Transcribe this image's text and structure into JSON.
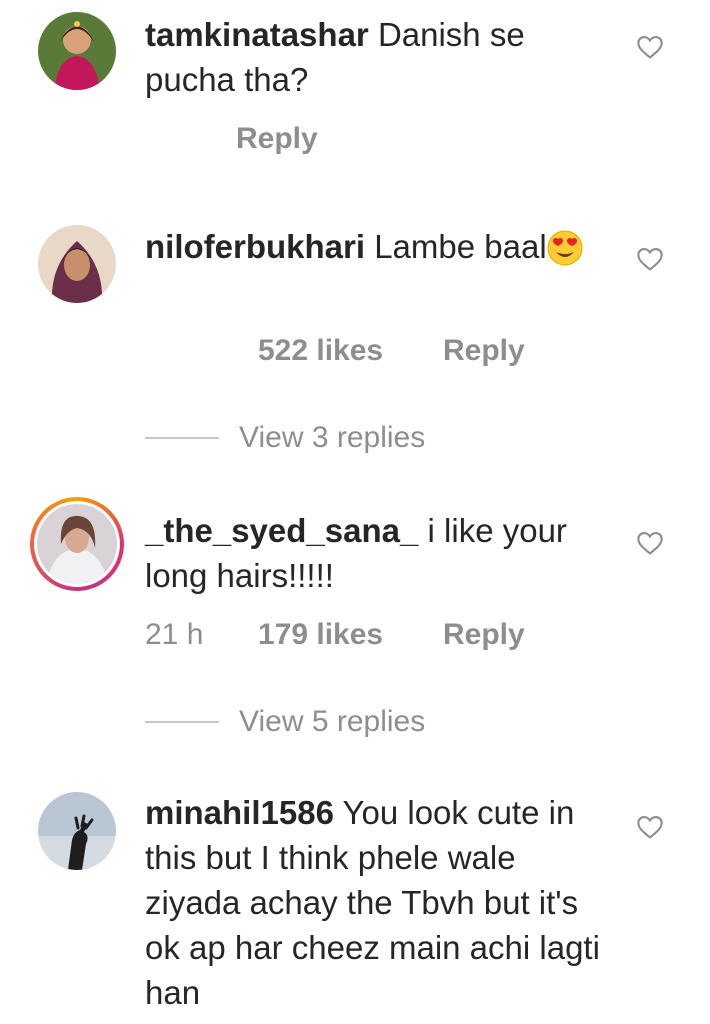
{
  "comments": [
    {
      "username": "tamkinatashar",
      "text": "Danish se pucha tha?",
      "reply_label": "Reply"
    },
    {
      "username": "niloferbukhari",
      "text": "Lambe baal",
      "emoji": "heart-eyes-emoji",
      "likes": "522 likes",
      "reply_label": "Reply",
      "view_replies": "View 3 replies"
    },
    {
      "username": "_the_syed_sana_",
      "text": "i like your long hairs!!!!!",
      "time": "21 h",
      "likes": "179 likes",
      "reply_label": "Reply",
      "view_replies": "View 5 replies",
      "has_story_ring": true
    },
    {
      "username": "minahil1586",
      "text": "You look cute in this but I think phele wale ziyada achay the Tbvh but it's ok ap har cheez main achi lagti han"
    }
  ],
  "icons": {
    "like": "heart-outline-icon"
  },
  "colors": {
    "text": "#262626",
    "muted": "#8e8e8e",
    "divider": "#c7c7c7",
    "story_ring": "#e1306c"
  }
}
